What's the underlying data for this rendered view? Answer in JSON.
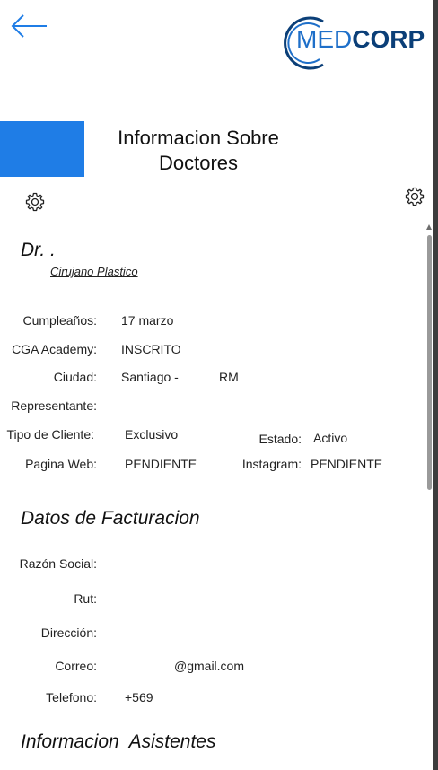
{
  "header": {
    "logo": {
      "med": "MED",
      "corp": "CORP"
    }
  },
  "page": {
    "title_line1": "Informacion Sobre",
    "title_line2": "Doctores"
  },
  "doctor": {
    "name": "Dr. .",
    "specialty": "Cirujano Plastico"
  },
  "info": {
    "birthday_label": "Cumpleaños:",
    "birthday_value": "17 marzo",
    "academy_label": "CGA Academy:",
    "academy_value": "INSCRITO",
    "city_label": "Ciudad:",
    "city_value": "Santiago -",
    "region_value": "RM",
    "rep_label": "Representante:",
    "client_type_label": "Tipo de Cliente:",
    "client_type_value": "Exclusivo",
    "status_label": "Estado:",
    "status_value": "Activo",
    "website_label": "Pagina Web:",
    "website_value": "PENDIENTE",
    "instagram_label": "Instagram:",
    "instagram_value": "PENDIENTE"
  },
  "billing": {
    "title": "Datos de Facturacion",
    "company_label": "Razón Social:",
    "rut_label": "Rut:",
    "address_label": "Dirección:",
    "email_label": "Correo:",
    "email_value": "@gmail.com",
    "phone_label": "Telefono:",
    "phone_value": "+569"
  },
  "assistants": {
    "title": "Informacion  Asistentes"
  },
  "colors": {
    "brand_blue": "#1f7de6",
    "logo_dark": "#0b3f78"
  },
  "icons": [
    "back-arrow-icon",
    "gear-icon"
  ]
}
